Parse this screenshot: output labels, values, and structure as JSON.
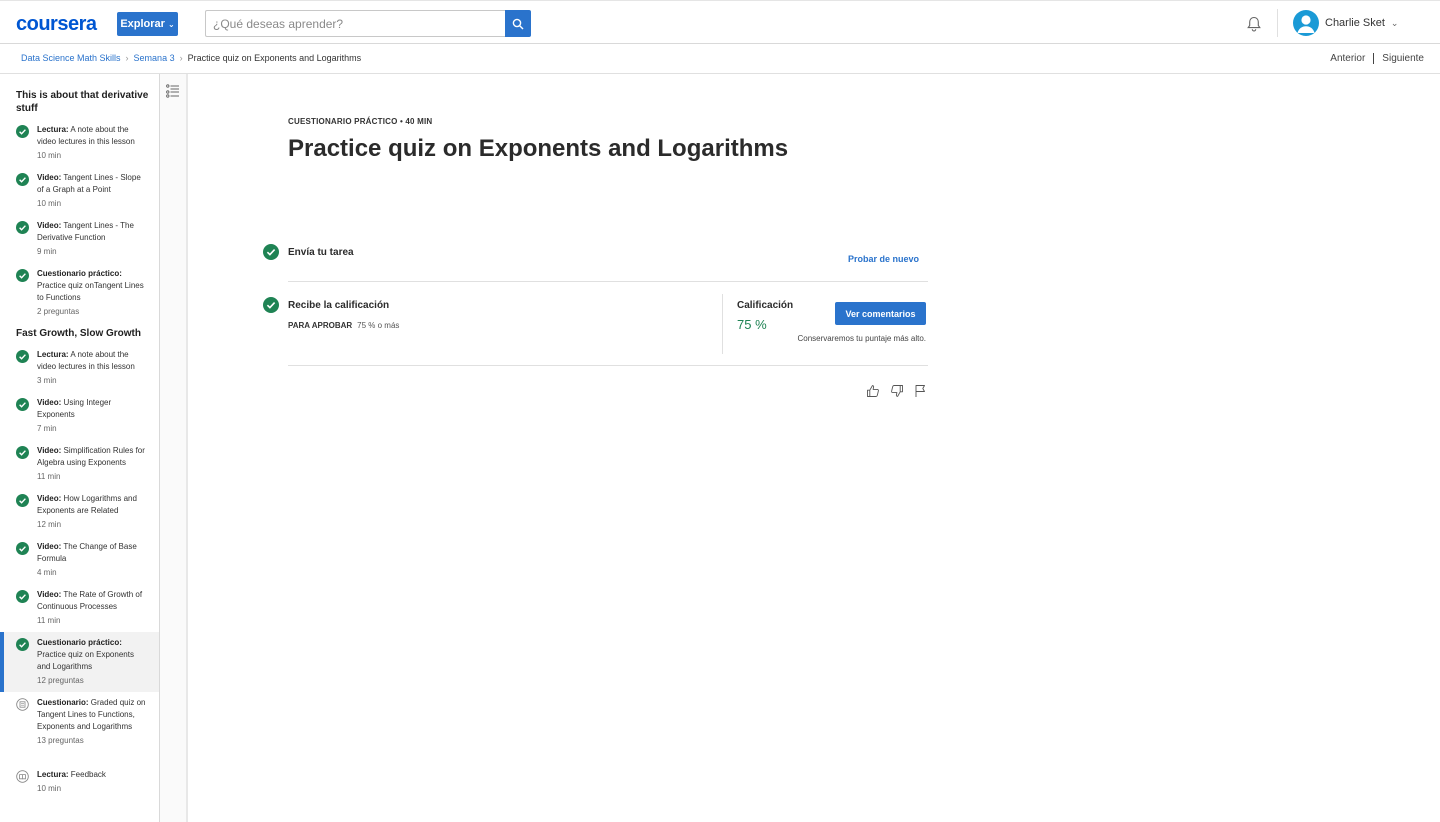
{
  "header": {
    "logo": "coursera",
    "explore_label": "Explorar",
    "search_placeholder": "¿Qué deseas aprender?",
    "user_name": "Charlie Sket",
    "icons": [
      "search-icon",
      "bell-icon",
      "avatar-icon",
      "chevron-down-icon"
    ]
  },
  "breadcrumb": {
    "items": [
      "Data Science Math Skills",
      "Semana 3"
    ],
    "current": "Practice quiz on Exponents and Logarithms"
  },
  "nav": {
    "prev": "Anterior",
    "next": "Siguiente"
  },
  "sidebar": {
    "sections": [
      {
        "title": "This is about that derivative stuff",
        "items": [
          {
            "type": "Lectura:",
            "title": "A note about the video lectures in this lesson",
            "duration": "10 min",
            "status": "done"
          },
          {
            "type": "Video:",
            "title": "Tangent Lines - Slope of a Graph at a Point",
            "duration": "10 min",
            "status": "done"
          },
          {
            "type": "Video:",
            "title": "Tangent Lines - The Derivative Function",
            "duration": "9 min",
            "status": "done"
          },
          {
            "type": "Cuestionario práctico:",
            "title": "Practice quiz onTangent Lines to Functions",
            "duration": "2 preguntas",
            "status": "done"
          }
        ]
      },
      {
        "title": "Fast Growth, Slow Growth",
        "items": [
          {
            "type": "Lectura:",
            "title": "A note about the video lectures in this lesson",
            "duration": "3 min",
            "status": "done"
          },
          {
            "type": "Video:",
            "title": "Using Integer Exponents",
            "duration": "7 min",
            "status": "done"
          },
          {
            "type": "Video:",
            "title": "Simplification Rules for Algebra using Exponents",
            "duration": "11 min",
            "status": "done"
          },
          {
            "type": "Video:",
            "title": "How Logarithms and Exponents are Related",
            "duration": "12 min",
            "status": "done"
          },
          {
            "type": "Video:",
            "title": "The Change of Base Formula",
            "duration": "4 min",
            "status": "done"
          },
          {
            "type": "Video:",
            "title": "The Rate of Growth of Continuous Processes",
            "duration": "11 min",
            "status": "done"
          },
          {
            "type": "Cuestionario práctico:",
            "title": "Practice quiz on Exponents and Logarithms",
            "duration": "12 preguntas",
            "status": "done-active"
          },
          {
            "type": "Cuestionario:",
            "title": "Graded quiz on Tangent Lines to Functions, Exponents and Logarithms",
            "duration": "13 preguntas",
            "status": "todo"
          },
          {
            "type": "Lectura:",
            "title": "Feedback",
            "duration": "10 min",
            "status": "todo"
          }
        ]
      }
    ]
  },
  "main": {
    "kicker": "CUESTIONARIO PRÁCTICO • 40 MIN",
    "title": "Practice quiz on Exponents and Logarithms",
    "step1": "Envía tu tarea",
    "retry": "Probar de nuevo",
    "step2": "Recibe la calificación",
    "pass_label": "PARA APROBAR",
    "pass_value": "75 % o más",
    "grade_label": "Calificación",
    "grade_value": "75 %",
    "feedback_button": "Ver comentarios",
    "keep_note": "Conservaremos tu puntaje más alto."
  },
  "colors": {
    "accent": "#2a73cc",
    "success": "#1f8354",
    "logo": "#0056d2"
  }
}
